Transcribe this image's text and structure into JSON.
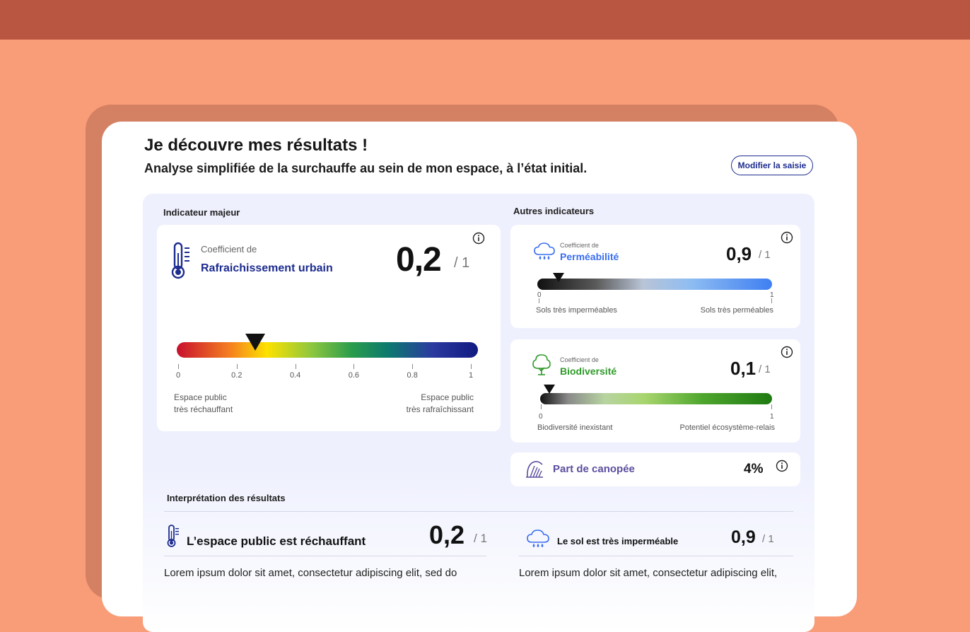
{
  "header": {
    "title": "Je découvre mes résultats !",
    "subtitle": "Analyse simplifiée de la surchauffe au sein de mon espace, à l’état initial.",
    "modify_button": "Modifier la saisie"
  },
  "major": {
    "section_label": "Indicateur majeur",
    "coef_prefix": "Coefficient de",
    "coef_name": "Rafraichissement urbain",
    "value": "0,2",
    "denominator": "/ 1",
    "marker_value": 0.26,
    "scale_ticks": [
      "0",
      "0.2",
      "0.4",
      "0.6",
      "0.8",
      "1"
    ],
    "left_label_line1": "Espace public",
    "left_label_line2": "très réchauffant",
    "right_label_line1": "Espace public",
    "right_label_line2": "très rafraîchissant"
  },
  "others": {
    "section_label": "Autres indicateurs",
    "permeability": {
      "coef_prefix": "Coefficient de",
      "coef_name": "Perméabilité",
      "value": "0,9",
      "denominator": "/ 1",
      "marker_value": 0.09,
      "tick_min": "0",
      "tick_max": "1",
      "left_label": "Sols très imperméables",
      "right_label": "Sols très perméables"
    },
    "biodiversity": {
      "coef_prefix": "Coefficient de",
      "coef_name": "Biodiversité",
      "value": "0,1",
      "denominator": "/ 1",
      "marker_value": 0.04,
      "tick_min": "0",
      "tick_max": "1",
      "left_label": "Biodiversité inexistant",
      "right_label": "Potentiel écosystème-relais"
    },
    "canopy": {
      "label": "Part de canopée",
      "value": "4%"
    }
  },
  "interpretation": {
    "section_label": "Interprétation des résultats",
    "left": {
      "heading": "L’espace public est réchauffant",
      "value": "0,2",
      "denominator": "/ 1",
      "text": "Lorem ipsum dolor sit amet, consectetur adipiscing elit, sed do"
    },
    "right": {
      "heading": "Le sol est très imperméable",
      "value": "0,9",
      "denominator": "/ 1",
      "text": "Lorem ipsum dolor sit amet, consectetur adipiscing elit,"
    }
  },
  "colors": {
    "background": "#f99c78",
    "topbar": "#b85642",
    "navy": "#1d2c8f",
    "permeability_blue": "#3a6ff0",
    "biodiversity_green": "#2f9a2a",
    "canopy_purple": "#5b4e9e"
  },
  "icons": [
    "thermometer-icon",
    "cloud-rain-icon",
    "tree-icon",
    "canopy-icon",
    "info-icon"
  ]
}
